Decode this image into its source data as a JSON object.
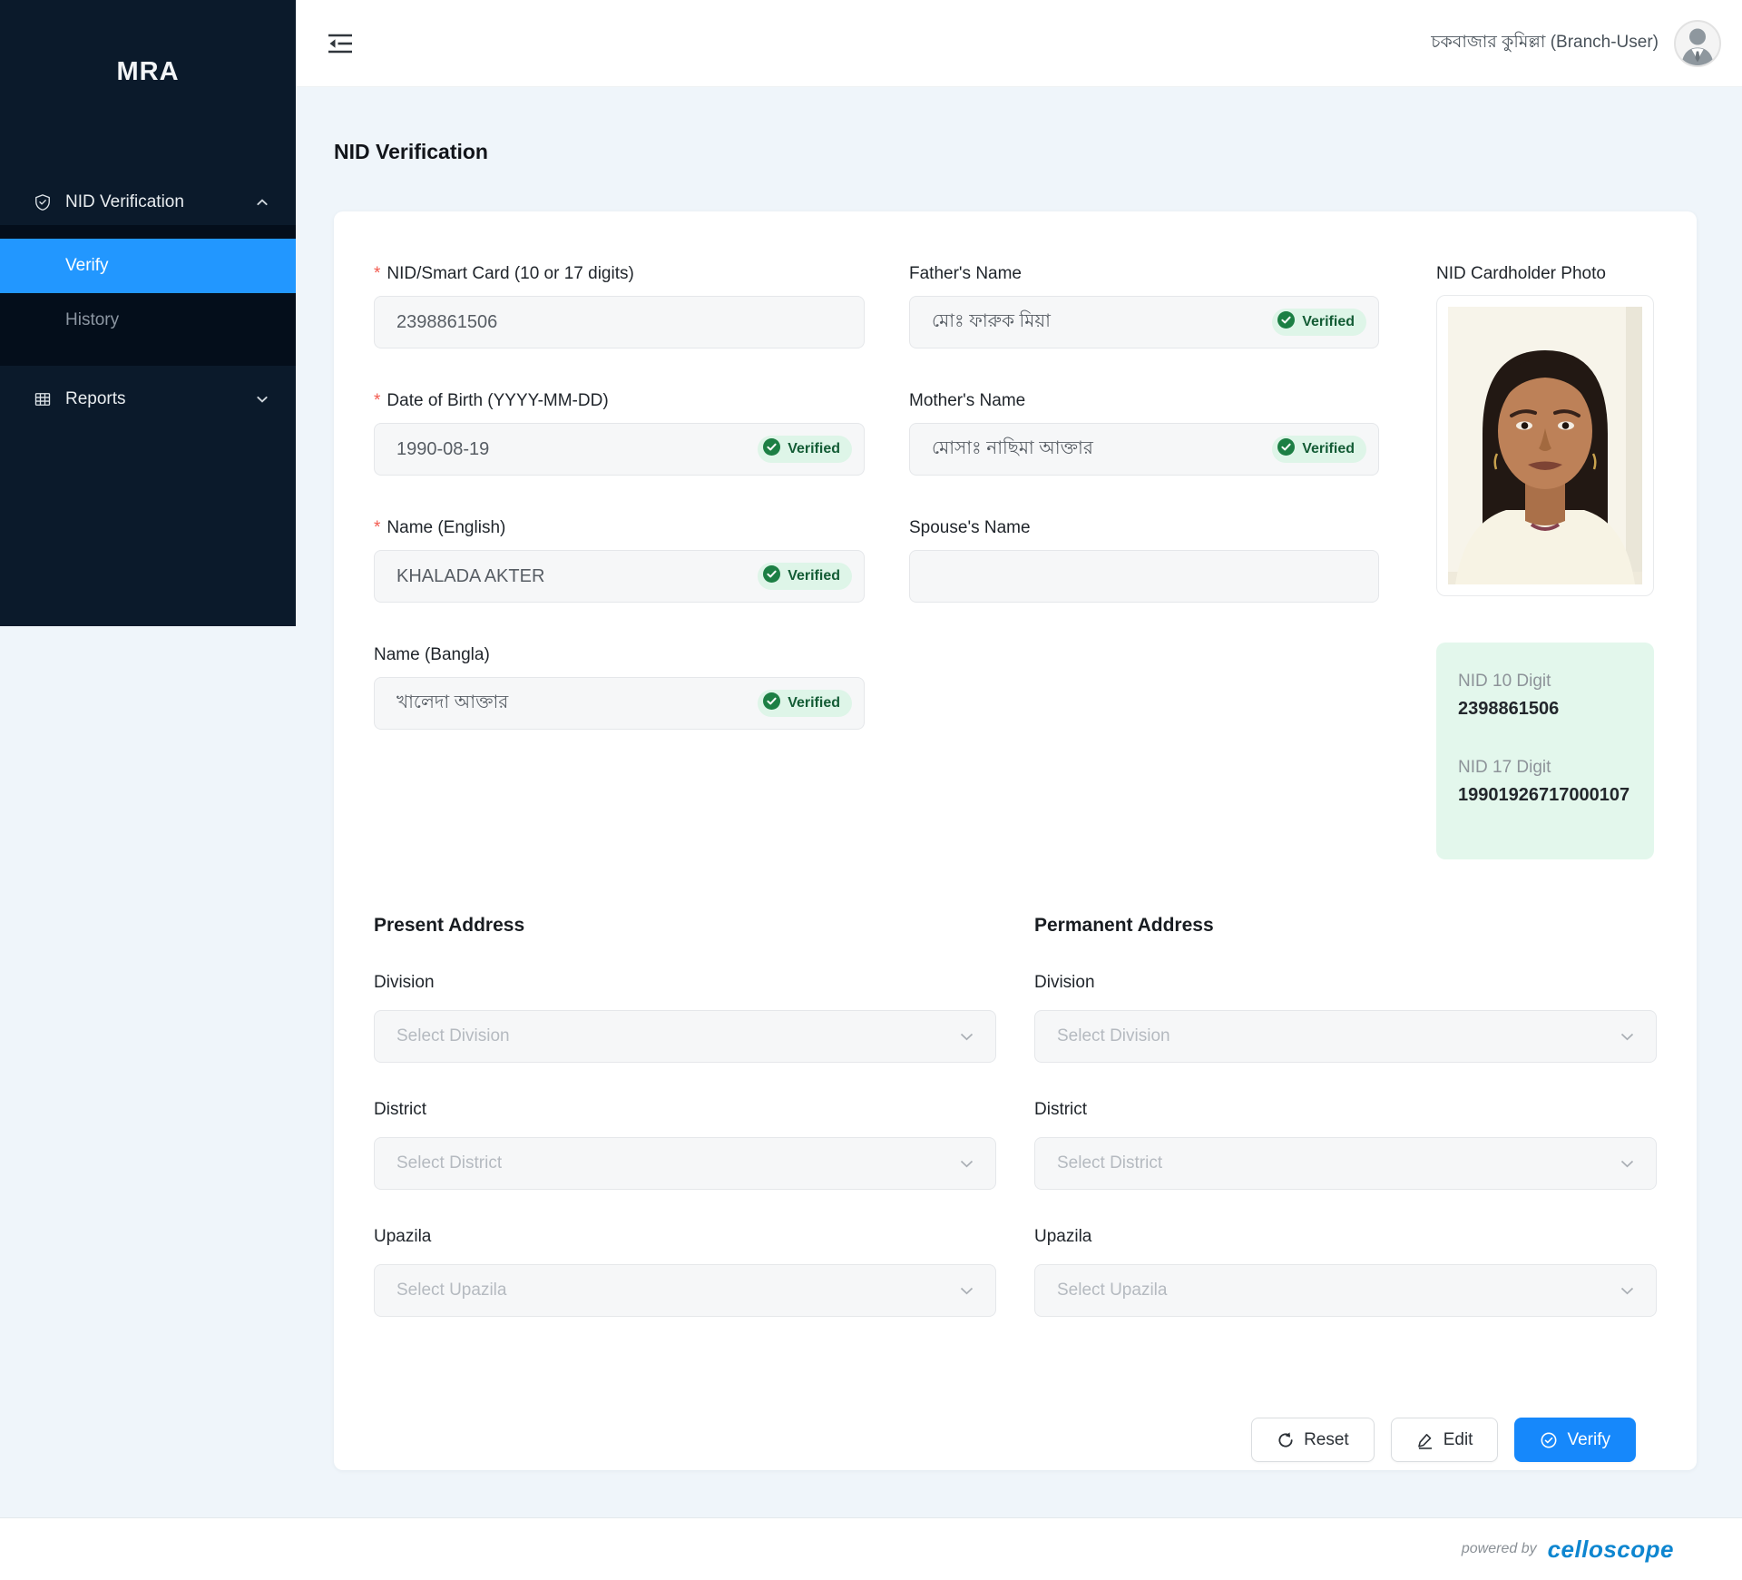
{
  "colors": {
    "sidebar_bg": "#0b1a2b",
    "submenu_bg": "#040e1b",
    "active_menu_blue": "#2297ff",
    "verify_button_blue": "#1688fb",
    "verified_badge_bg": "#def5e8",
    "verified_badge_green": "#1c7f44",
    "verified_text_green": "#135c35",
    "nid_summary_bg": "#e3f7ec",
    "page_bg": "#eff5fa",
    "required_red": "#f25a4f",
    "celloscope_blue": "#0e86d0"
  },
  "sidebar": {
    "logo": "MRA",
    "items": [
      {
        "label": "NID Verification",
        "icon": "safety-certificate-icon",
        "expanded": true
      },
      {
        "label": "Verify",
        "active": true
      },
      {
        "label": "History"
      },
      {
        "label": "Reports",
        "icon": "table-icon",
        "expanded": false
      }
    ]
  },
  "header": {
    "user": "চকবাজার কুমিল্লা (Branch-User)"
  },
  "page": {
    "title": "NID Verification"
  },
  "form": {
    "nid": {
      "required": "*",
      "label": "NID/Smart Card (10 or 17 digits)",
      "value": "2398861506"
    },
    "dob": {
      "required": "*",
      "label": "Date of Birth (YYYY-MM-DD)",
      "value": "1990-08-19",
      "badge": "Verified"
    },
    "name_en": {
      "required": "*",
      "label": "Name (English)",
      "value": "KHALADA AKTER",
      "badge": "Verified"
    },
    "name_bn": {
      "label": "Name (Bangla)",
      "value": "খালেদা আক্তার",
      "badge": "Verified"
    },
    "father": {
      "label": "Father's Name",
      "value": "মোঃ ফারুক মিয়া",
      "badge": "Verified"
    },
    "mother": {
      "label": "Mother's Name",
      "value": "মোসাঃ নাছিমা আক্তার",
      "badge": "Verified"
    },
    "spouse": {
      "label": "Spouse's Name",
      "value": ""
    },
    "photo": {
      "label": "NID Cardholder Photo"
    }
  },
  "nid_summary": {
    "nid10_label": "NID 10 Digit",
    "nid10_value": "2398861506",
    "nid17_label": "NID 17 Digit",
    "nid17_value": "19901926717000107"
  },
  "present_address": {
    "title": "Present Address",
    "division": {
      "label": "Division",
      "placeholder": "Select Division"
    },
    "district": {
      "label": "District",
      "placeholder": "Select District"
    },
    "upazila": {
      "label": "Upazila",
      "placeholder": "Select Upazila"
    }
  },
  "permanent_address": {
    "title": "Permanent Address",
    "division": {
      "label": "Division",
      "placeholder": "Select Division"
    },
    "district": {
      "label": "District",
      "placeholder": "Select District"
    },
    "upazila": {
      "label": "Upazila",
      "placeholder": "Select Upazila"
    }
  },
  "actions": {
    "reset": "Reset",
    "edit": "Edit",
    "verify": "Verify"
  },
  "footer": {
    "powered_by": "powered by",
    "brand": "celloscope"
  }
}
